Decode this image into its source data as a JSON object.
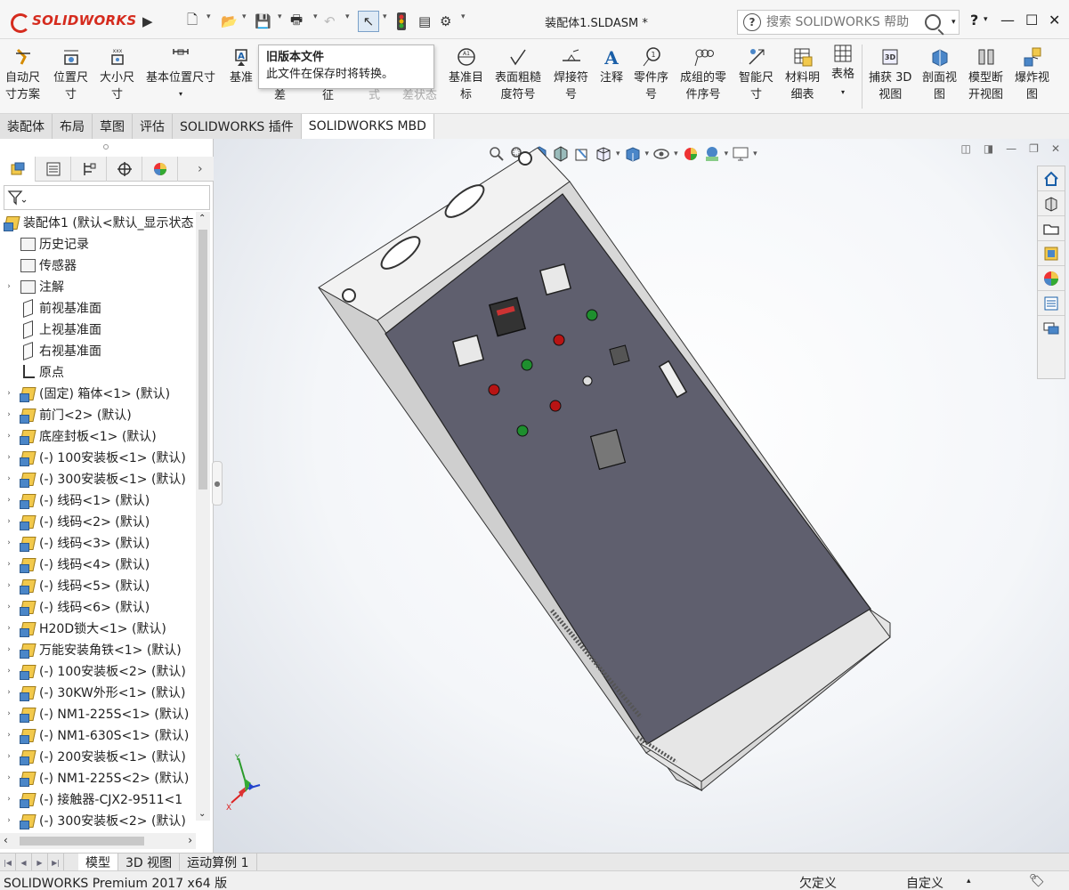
{
  "app": {
    "logo_text": "SOLIDWORKS",
    "doc_title": "装配体1.SLDASM *",
    "search_placeholder": "搜索 SOLIDWORKS 帮助",
    "help_label": "?",
    "minimize": "—",
    "maximize": "☐",
    "close": "✕"
  },
  "tooltip": {
    "title": "旧版本文件",
    "body": "此文件在保存时将转换。"
  },
  "ribbon": {
    "items": [
      {
        "label": "自动尺\n寸方案"
      },
      {
        "label": "位置尺\n寸"
      },
      {
        "label": "大小尺\n寸"
      },
      {
        "label": "基本位置尺寸"
      },
      {
        "label": "基准"
      },
      {
        "label": "差"
      },
      {
        "label": "征"
      },
      {
        "label": "式"
      },
      {
        "label": "差状态"
      },
      {
        "label": "基准目\n标"
      },
      {
        "label": "表面粗糙\n度符号"
      },
      {
        "label": "焊接符\n号"
      },
      {
        "label": "注释"
      },
      {
        "label": "零件序\n号"
      },
      {
        "label": "成组的零\n件序号"
      },
      {
        "label": "智能尺\n寸"
      },
      {
        "label": "材料明\n细表"
      },
      {
        "label": "表格"
      },
      {
        "label": "捕获 3D\n视图"
      },
      {
        "label": "剖面视\n图"
      },
      {
        "label": "模型断\n开视图"
      },
      {
        "label": "爆炸视\n图"
      }
    ]
  },
  "command_tabs": [
    "装配体",
    "布局",
    "草图",
    "评估",
    "SOLIDWORKS 插件",
    "SOLIDWORKS MBD"
  ],
  "tree": {
    "root": "装配体1 (默认<默认_显示状态",
    "items": [
      {
        "label": "历史记录",
        "icon": "history-icon",
        "exp": ""
      },
      {
        "label": "传感器",
        "icon": "sensor-icon",
        "exp": ""
      },
      {
        "label": "注解",
        "icon": "annotation-icon",
        "exp": "›"
      },
      {
        "label": "前视基准面",
        "icon": "plane-icon",
        "exp": ""
      },
      {
        "label": "上视基准面",
        "icon": "plane-icon",
        "exp": ""
      },
      {
        "label": "右视基准面",
        "icon": "plane-icon",
        "exp": ""
      },
      {
        "label": "原点",
        "icon": "origin-icon",
        "exp": ""
      },
      {
        "label": "(固定) 箱体<1> (默认)",
        "icon": "part-icon",
        "exp": "›"
      },
      {
        "label": "前门<2> (默认)",
        "icon": "part-icon",
        "exp": "›"
      },
      {
        "label": "底座封板<1> (默认)",
        "icon": "part-icon",
        "exp": "›"
      },
      {
        "label": "(-) 100安装板<1> (默认)",
        "icon": "part-icon",
        "exp": "›"
      },
      {
        "label": "(-) 300安装板<1> (默认)",
        "icon": "part-icon",
        "exp": "›"
      },
      {
        "label": "(-) 线码<1> (默认)",
        "icon": "part-icon",
        "exp": "›"
      },
      {
        "label": "(-) 线码<2> (默认)",
        "icon": "part-icon",
        "exp": "›"
      },
      {
        "label": "(-) 线码<3> (默认)",
        "icon": "part-icon",
        "exp": "›"
      },
      {
        "label": "(-) 线码<4> (默认)",
        "icon": "part-icon",
        "exp": "›"
      },
      {
        "label": "(-) 线码<5> (默认)",
        "icon": "part-icon",
        "exp": "›"
      },
      {
        "label": "(-) 线码<6> (默认)",
        "icon": "part-icon",
        "exp": "›"
      },
      {
        "label": "H20D锁大<1> (默认)",
        "icon": "part-icon",
        "exp": "›"
      },
      {
        "label": "万能安装角铁<1> (默认)",
        "icon": "part-icon",
        "exp": "›"
      },
      {
        "label": "(-) 100安装板<2> (默认)",
        "icon": "part-icon",
        "exp": "›"
      },
      {
        "label": "(-) 30KW外形<1> (默认)",
        "icon": "part-icon",
        "exp": "›"
      },
      {
        "label": "(-) NM1-225S<1> (默认)",
        "icon": "part-icon",
        "exp": "›"
      },
      {
        "label": "(-) NM1-630S<1> (默认)",
        "icon": "part-icon",
        "exp": "›"
      },
      {
        "label": "(-) 200安装板<1> (默认)",
        "icon": "part-icon",
        "exp": "›"
      },
      {
        "label": "(-) NM1-225S<2> (默认)",
        "icon": "part-icon",
        "exp": "›"
      },
      {
        "label": "(-) 接触器-CJX2-9511<1",
        "icon": "part-icon",
        "exp": "›"
      },
      {
        "label": "(-) 300安装板<2> (默认)",
        "icon": "part-icon",
        "exp": "›"
      }
    ]
  },
  "bottom_tabs": [
    "模型",
    "3D 视图",
    "运动算例 1"
  ],
  "status": {
    "left": "SOLIDWORKS Premium 2017 x64 版",
    "state": "欠定义",
    "units": "自定义"
  },
  "triad": {
    "x": "X",
    "y": "Y",
    "z": "Z"
  },
  "colors": {
    "accent": "#d52b1e",
    "panel_face": "#5f5f6e",
    "cabinet_side": "#d6d6d6"
  }
}
